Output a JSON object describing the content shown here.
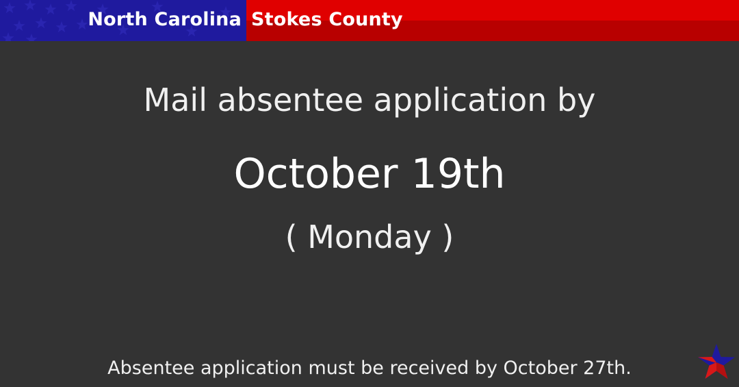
{
  "banner": {
    "state": "North Carolina",
    "county": "Stokes County",
    "left_color": "#1f1a9e",
    "right_color": "#e00000"
  },
  "main": {
    "headline": "Mail absentee application by",
    "date": "October 19th",
    "weekday": "( Monday )"
  },
  "footer": {
    "note": "Absentee application must be received by October 27th.",
    "logo_icon": "red-blue-star-icon"
  },
  "colors": {
    "background": "#333333",
    "text": "#f0f0f0"
  }
}
